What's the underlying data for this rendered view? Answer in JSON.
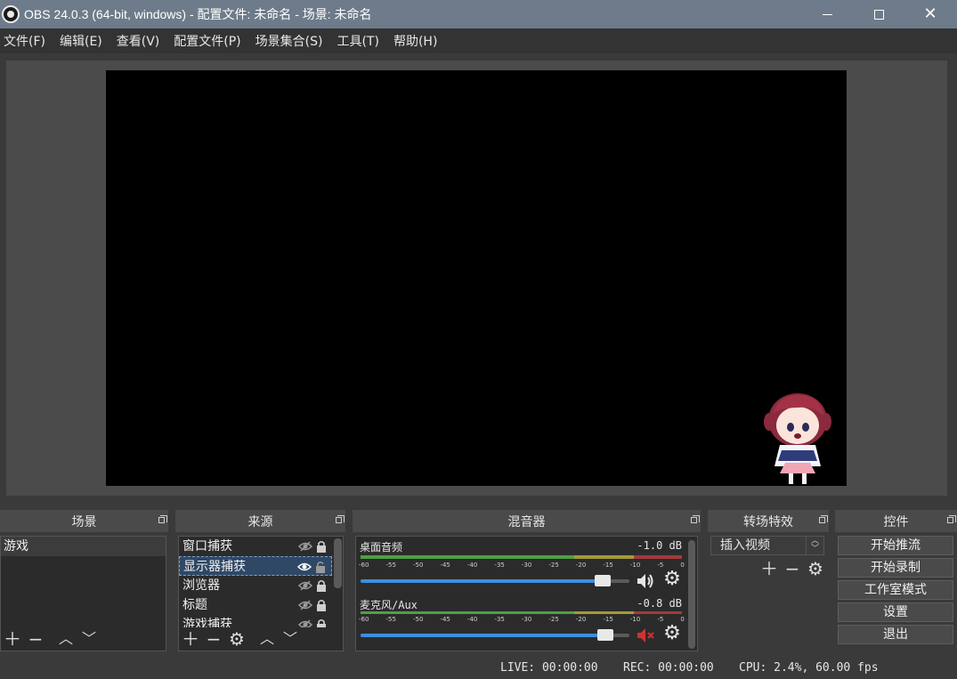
{
  "window": {
    "title": "OBS 24.0.3 (64-bit, windows) - 配置文件: 未命名 - 场景: 未命名"
  },
  "menu": [
    "文件(F)",
    "编辑(E)",
    "查看(V)",
    "配置文件(P)",
    "场景集合(S)",
    "工具(T)",
    "帮助(H)"
  ],
  "docks": {
    "scenes": "场景",
    "sources": "来源",
    "mixer": "混音器",
    "transitions": "转场特效",
    "controls": "控件"
  },
  "scenes": [
    {
      "name": "游戏"
    }
  ],
  "sources": [
    {
      "name": "窗口捕获",
      "visible": false,
      "locked": true
    },
    {
      "name": "显示器捕获",
      "visible": true,
      "locked": false,
      "selected": true
    },
    {
      "name": "浏览器",
      "visible": false,
      "locked": true
    },
    {
      "name": "标题",
      "visible": false,
      "locked": true
    },
    {
      "name": "游戏捕获",
      "visible": false,
      "locked": true
    }
  ],
  "mixer": {
    "scale": [
      "-60",
      "-55",
      "-50",
      "-45",
      "-40",
      "-35",
      "-30",
      "-25",
      "-20",
      "-15",
      "-10",
      "-5",
      "0"
    ],
    "channels": [
      {
        "name": "桌面音频",
        "db": "-1.0 dB",
        "volume": 0.93,
        "muted": false
      },
      {
        "name": "麦克风/Aux",
        "db": "-0.8 dB",
        "volume": 0.94,
        "muted": true
      }
    ]
  },
  "transitions": {
    "selected": "插入视频"
  },
  "controls": {
    "start_stream": "开始推流",
    "start_record": "开始录制",
    "studio_mode": "工作室模式",
    "settings": "设置",
    "exit": "退出"
  },
  "status": {
    "live": "LIVE: 00:00:00",
    "rec": "REC: 00:00:00",
    "cpu": "CPU: 2.4%, 60.00 fps"
  },
  "colors": {
    "accent": "#3d8ee0",
    "meter_green": "#4f9f45",
    "meter_yellow": "#a29a3a",
    "meter_red": "#a33a3a",
    "mute_red": "#d23030"
  }
}
